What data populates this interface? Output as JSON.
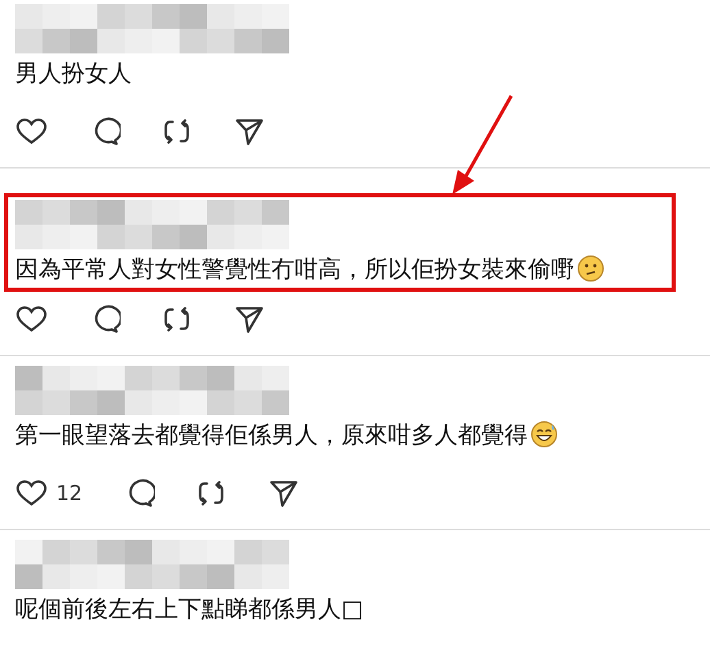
{
  "posts": [
    {
      "text": "男人扮女人",
      "highlighted": false,
      "show_actions": true
    },
    {
      "text": "因為平常人對女性警覺性冇咁高，所以佢扮女裝來偷嘢",
      "emoji_icon": {
        "kind": "wry"
      },
      "highlighted": true,
      "show_actions": true
    },
    {
      "text": "第一眼望落去都覺得佢係男人，原來咁多人都覺得",
      "emoji_icon": {
        "kind": "grin"
      },
      "like_count": "12",
      "highlighted": false,
      "show_actions": true
    },
    {
      "text": "呢個前後左右上下點睇都係男人□",
      "highlighted": false,
      "show_actions": false
    }
  ]
}
